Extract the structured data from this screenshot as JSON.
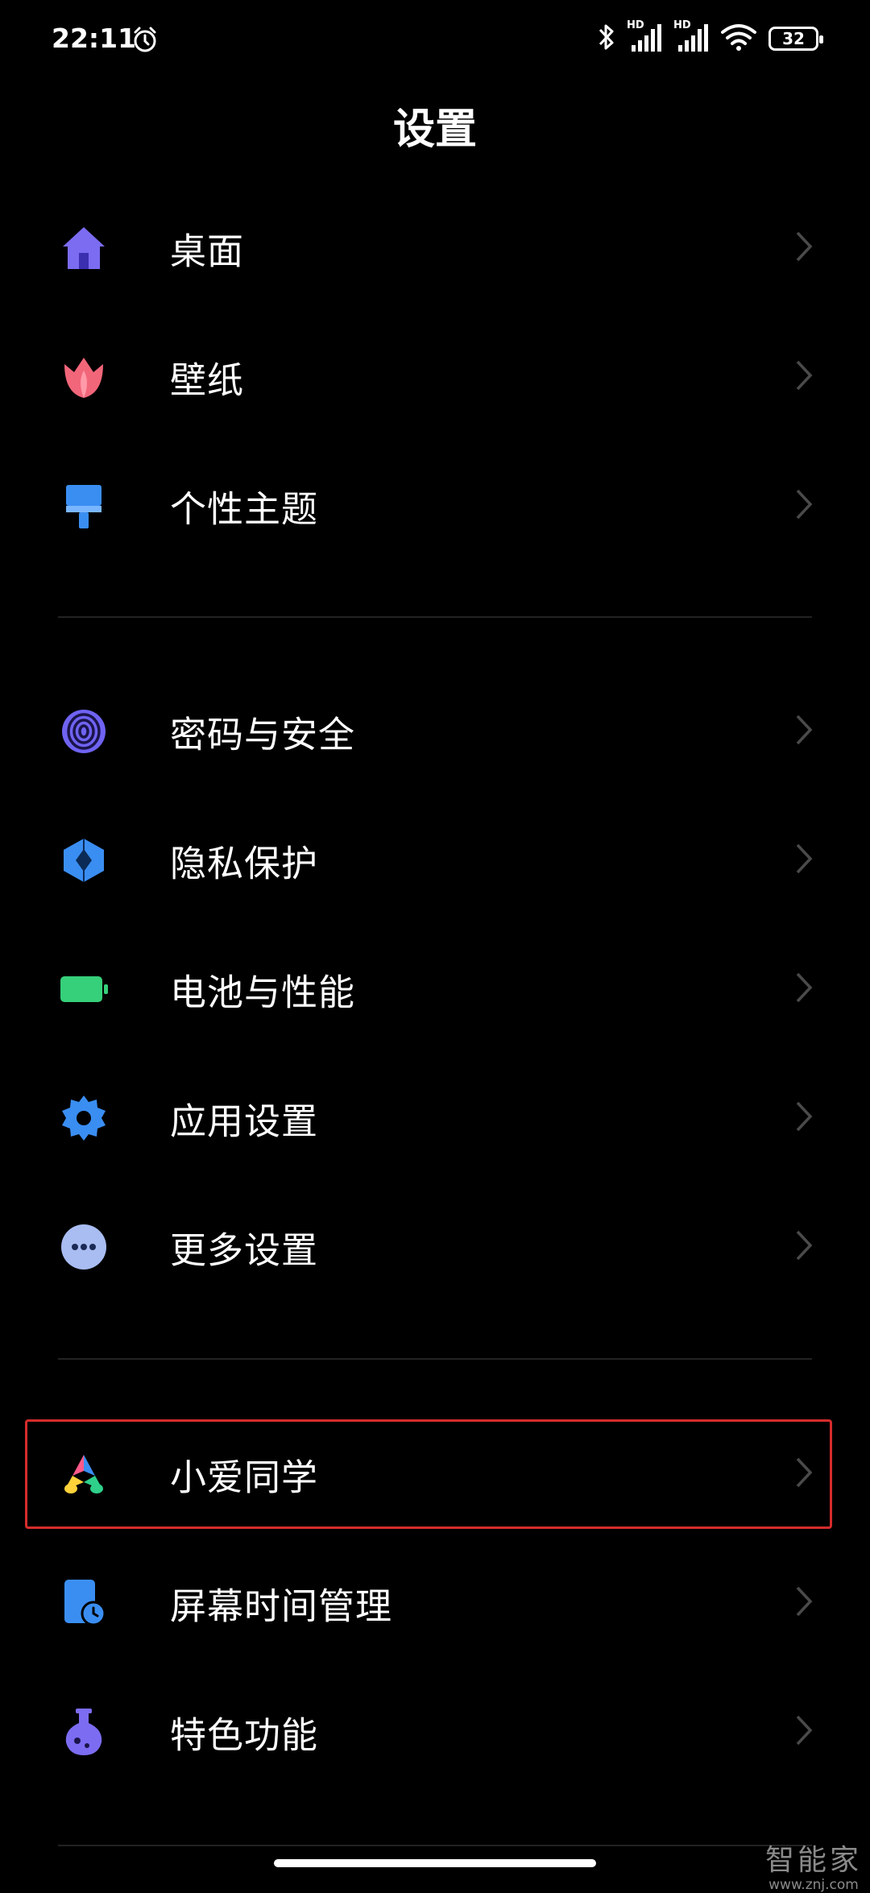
{
  "status_bar": {
    "time": "22:11",
    "hd1": "HD",
    "hd2": "HD",
    "battery": "32"
  },
  "header": {
    "title": "设置"
  },
  "settings": {
    "items": [
      {
        "label": "桌面",
        "icon": "home-icon",
        "color": "#7c6cf2"
      },
      {
        "label": "壁纸",
        "icon": "tulip-icon",
        "color": "#f2667a"
      },
      {
        "label": "个性主题",
        "icon": "brush-icon",
        "color": "#3a8ef2"
      },
      {
        "label": "密码与安全",
        "icon": "fingerprint-icon",
        "color": "#6f63f2"
      },
      {
        "label": "隐私保护",
        "icon": "shield-icon",
        "color": "#3a8ef2"
      },
      {
        "label": "电池与性能",
        "icon": "battery-icon",
        "color": "#36d07a"
      },
      {
        "label": "应用设置",
        "icon": "gear-icon",
        "color": "#3a8ef2"
      },
      {
        "label": "更多设置",
        "icon": "more-icon",
        "color": "#a9bdf2"
      },
      {
        "label": "小爱同学",
        "icon": "xiaoai-icon",
        "color": "#3a8ef2"
      },
      {
        "label": "屏幕时间管理",
        "icon": "screen-time-icon",
        "color": "#3a8ef2"
      },
      {
        "label": "特色功能",
        "icon": "flask-icon",
        "color": "#7c6cf2"
      }
    ]
  },
  "watermark": {
    "line1": "智能家",
    "line2": "www.znj.com"
  }
}
